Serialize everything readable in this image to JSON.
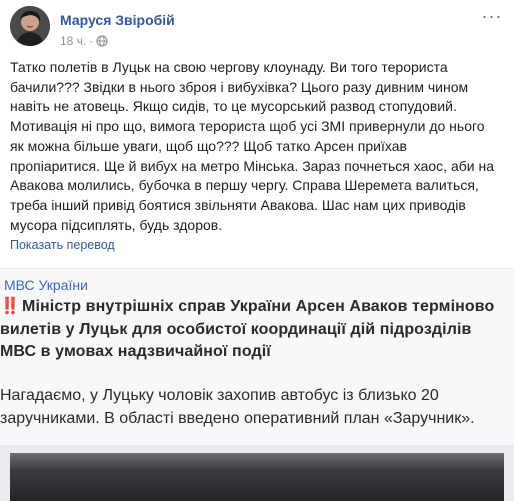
{
  "post": {
    "author": "Маруся Звіробій",
    "time": "18 ч.",
    "dot": "·",
    "more_label": "···",
    "lines": [
      "Татко полетів в Луцьк на свою чергову клоунаду. Ви того терориста",
      "бачили??? Звідки в нього зброя і вибухівка? Цього разу дивним чином",
      "навіть не атовець. Якщо сидів, то це мусорський развод стопудовий.",
      "Мотивація ні про що, вимога терориста щоб усі ЗМІ привернули до нього",
      "як можна більше уваги, щоб що??? Щоб татко Арсен приїхав",
      "пропіаритися. Ще й вибух на метро Мінська. Зараз почнеться хаос, аби на",
      "Авакова молились, бубочка в першу чергу. Справа Шеремета валиться,",
      "треба інший привід боятися звільняти Авакова. Шас нам цих приводів",
      "мусора підсиплять, будь здоров."
    ],
    "translate_label": "Показать перевод"
  },
  "shared": {
    "source": "МВС України",
    "alert_glyph": "‼️",
    "headline_lines": [
      "Міністр внутрішніх справ України Арсен Аваков терміново",
      "вилетів у Луцьк для особистої координації дій підрозділів",
      "МВС в умовах надзвичайної події"
    ],
    "body_lines": [
      "Нагадаємо, у Луцьку чоловік захопив автобус із близько 20",
      "заручниками. В області введено оперативний план «Заручник»."
    ]
  },
  "icons": {
    "privacy": "globe-icon",
    "menu": "more-options-icon",
    "alert": "double-exclamation-icon"
  },
  "colors": {
    "author": "#365899",
    "link": "#385898",
    "source": "#4267b2",
    "alert": "#d8242a"
  }
}
